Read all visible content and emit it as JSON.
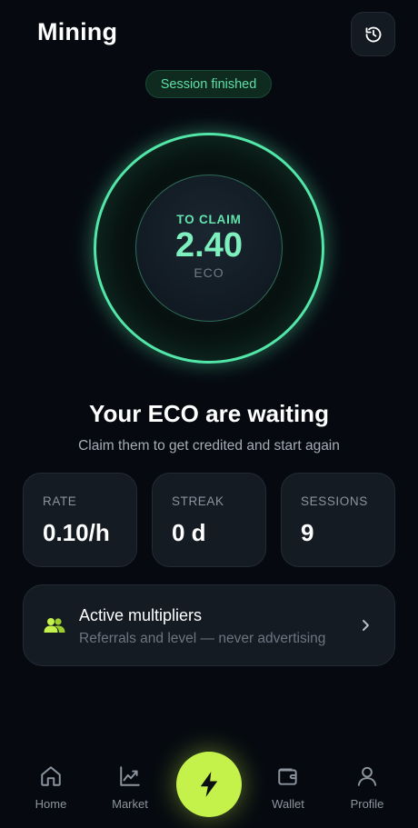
{
  "header": {
    "title": "Mining",
    "history_icon": "history-icon"
  },
  "status": {
    "label": "Session finished"
  },
  "claim": {
    "label": "TO CLAIM",
    "value": "2.40",
    "unit": "ECO"
  },
  "message": {
    "headline": "Your ECO are waiting",
    "subline": "Claim them to get credited and start again"
  },
  "stats": [
    {
      "label": "RATE",
      "value": "0.10/h"
    },
    {
      "label": "STREAK",
      "value": "0 d"
    },
    {
      "label": "SESSIONS",
      "value": "9"
    }
  ],
  "multipliers": {
    "title": "Active multipliers",
    "subtitle": "Referrals and level — never advertising",
    "icon": "users-icon"
  },
  "nav": {
    "items": [
      {
        "label": "Home",
        "icon": "home-icon"
      },
      {
        "label": "Market",
        "icon": "chart-icon"
      },
      {
        "label": "Wallet",
        "icon": "wallet-icon"
      },
      {
        "label": "Profile",
        "icon": "user-icon"
      }
    ],
    "center_icon": "lightning-icon"
  },
  "colors": {
    "background": "#060a10",
    "accent_green": "#52e6a8",
    "accent_lime": "#c4f24a",
    "card": "#141b23"
  }
}
